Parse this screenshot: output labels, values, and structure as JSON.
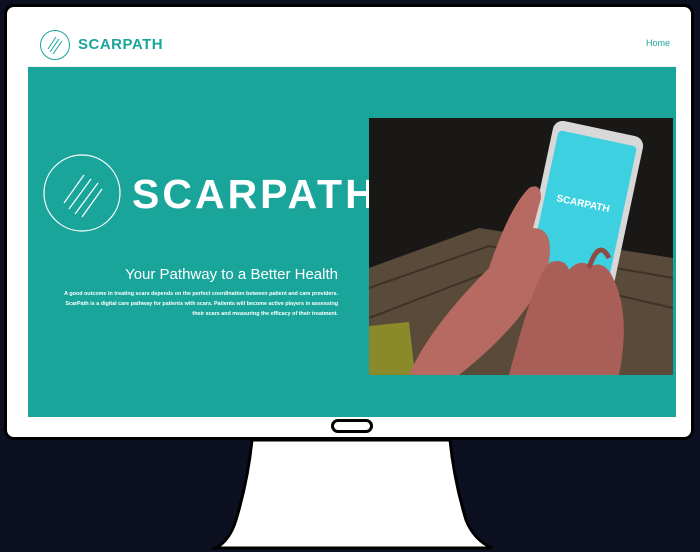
{
  "nav": {
    "brand": "SCARPATH",
    "home_label": "Home"
  },
  "hero": {
    "brand": "SCARPATH",
    "title": "Your Pathway to a Better Health",
    "description": "A good outcome in treating scars depends on the perfect coordination between patient and care providers. ScarPath is a digital care pathway for patients with scars. Patients will become active players in assessing their scars and measuring the efficacy of their treatment."
  },
  "photo": {
    "phone_screen_text": "SCARPATH"
  },
  "colors": {
    "accent": "#1aa59b",
    "background": "#0c1020",
    "monitor": "#ffffff"
  }
}
